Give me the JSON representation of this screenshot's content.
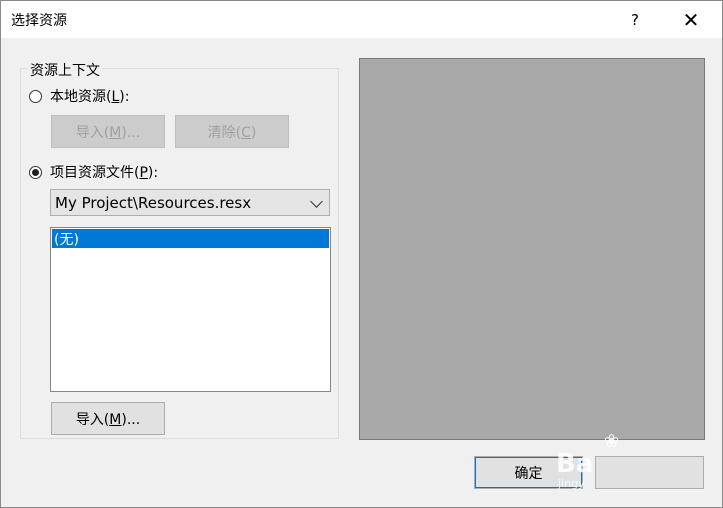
{
  "window": {
    "title": "选择资源",
    "help_glyph": "?",
    "close_glyph": "✕"
  },
  "context_group": {
    "legend": "资源上下文",
    "local_resource": {
      "label_prefix": "本地资源(",
      "accel": "L",
      "label_suffix": "):",
      "checked": false
    },
    "import_local_button": {
      "prefix": "导入(",
      "accel": "M",
      "suffix": ")...",
      "enabled": false
    },
    "clear_button": {
      "prefix": "清除(",
      "accel": "C",
      "suffix": ")",
      "enabled": false
    },
    "project_resource": {
      "label_prefix": "项目资源文件(",
      "accel": "P",
      "label_suffix": "):",
      "checked": true
    },
    "resource_file_combo": {
      "value": "My Project\\Resources.resx"
    },
    "resource_list": {
      "items": [
        "(无)"
      ],
      "selected_index": 0
    },
    "import_project_button": {
      "prefix": "导入(",
      "accel": "M",
      "suffix": ")...",
      "enabled": true
    }
  },
  "preview": {
    "background": "#a9a9a9"
  },
  "footer": {
    "ok_label": "确定",
    "cancel_label": ""
  },
  "watermark": {
    "big": "Ba",
    "small": "jingy"
  }
}
